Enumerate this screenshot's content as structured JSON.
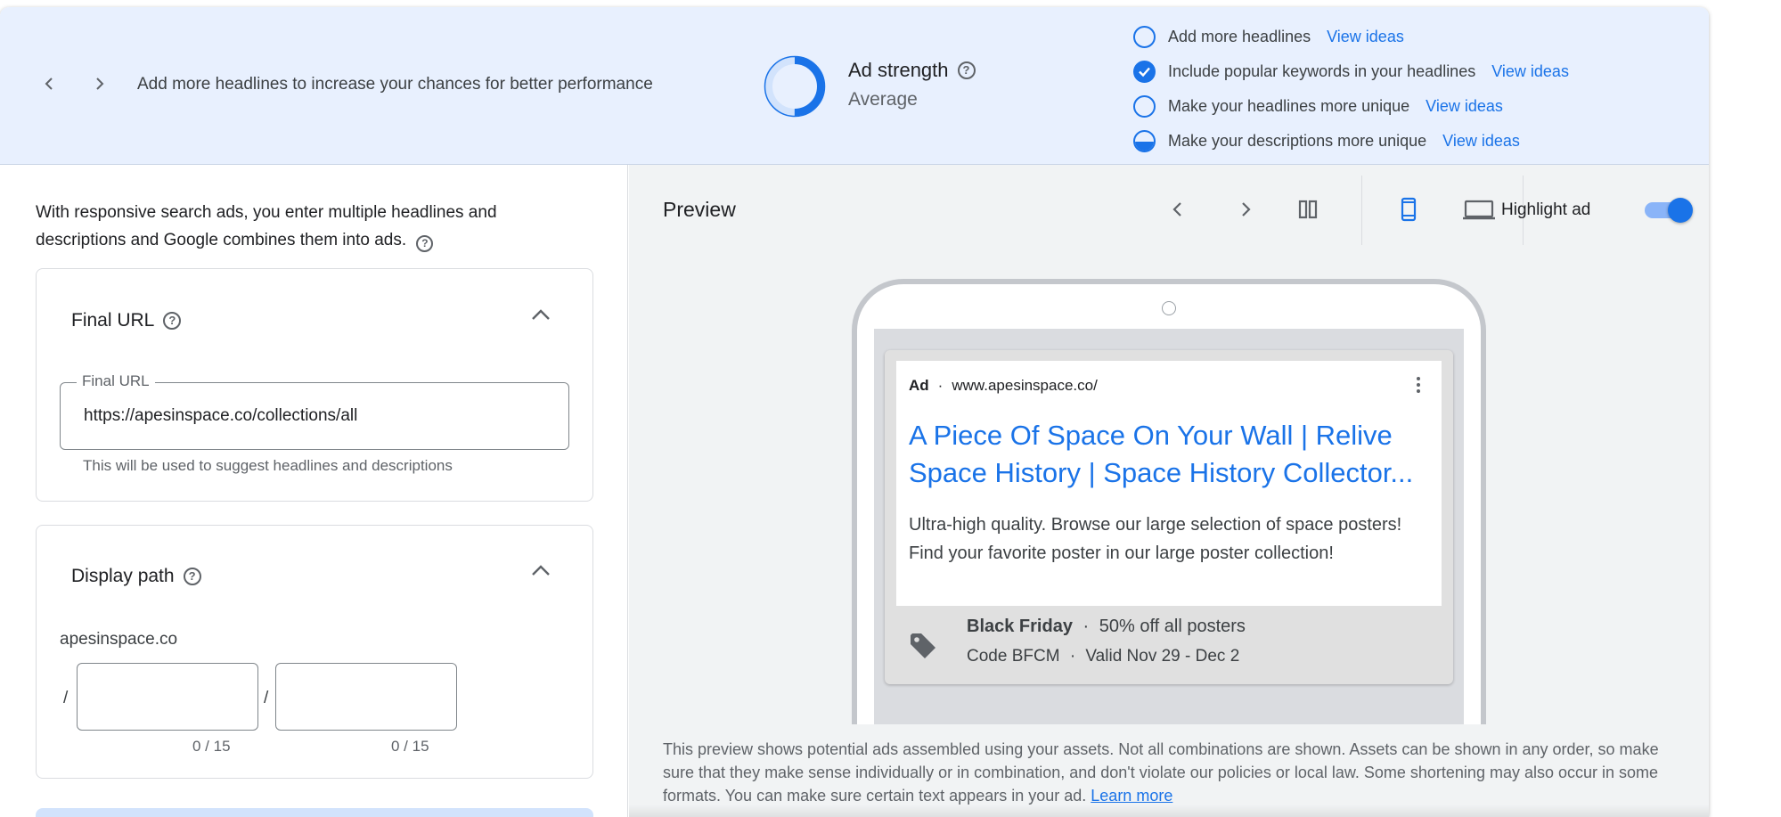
{
  "banner": {
    "message": "Add more headlines to increase your chances for better performance",
    "strength_label": "Ad strength",
    "strength_value": "Average",
    "strength_progress": 0.5,
    "tips": [
      {
        "text": "Add more headlines",
        "link": "View ideas",
        "state": "empty"
      },
      {
        "text": "Include popular keywords in your headlines",
        "link": "View ideas",
        "state": "done"
      },
      {
        "text": "Make your headlines more unique",
        "link": "View ideas",
        "state": "empty"
      },
      {
        "text": "Make your descriptions more unique",
        "link": "View ideas",
        "state": "half"
      }
    ]
  },
  "left": {
    "intro": "With responsive search ads, you enter multiple headlines and descriptions and Google combines them into ads.",
    "final_url": {
      "title": "Final URL",
      "field_label": "Final URL",
      "value": "https://apesinspace.co/collections/all",
      "hint": "This will be used to suggest headlines and descriptions"
    },
    "display_path": {
      "title": "Display path",
      "domain": "apesinspace.co",
      "slash": "/",
      "path1_count": "0 / 15",
      "path2_count": "0 / 15"
    }
  },
  "preview": {
    "title": "Preview",
    "highlight_label": "Highlight ad",
    "highlight_on": true,
    "ad": {
      "badge": "Ad",
      "separator": "·",
      "url": "www.apesinspace.co/",
      "headline": "A Piece Of Space On Your Wall | Relive Space History | Space History Collector...",
      "description": "Ultra-high quality. Browse our large selection of space posters! Find your favorite poster in our large poster collection!",
      "promo_event": "Black Friday",
      "promo_offer": "50% off all posters",
      "promo_code": "Code BFCM",
      "promo_dates": "Valid Nov 29 - Dec 2"
    },
    "footnote": "This preview shows potential ads assembled using your assets. Not all combinations are shown. Assets can be shown in any order, so make sure that they make sense individually or in combination, and don't violate our policies or local law. Some shortening may also occur in some formats. You can make sure certain text appears in your ad.",
    "learn_more": "Learn more"
  },
  "colors": {
    "accent": "#1a73e8",
    "banner_bg": "#e8f0fe",
    "panel_bg": "#f1f3f4"
  }
}
